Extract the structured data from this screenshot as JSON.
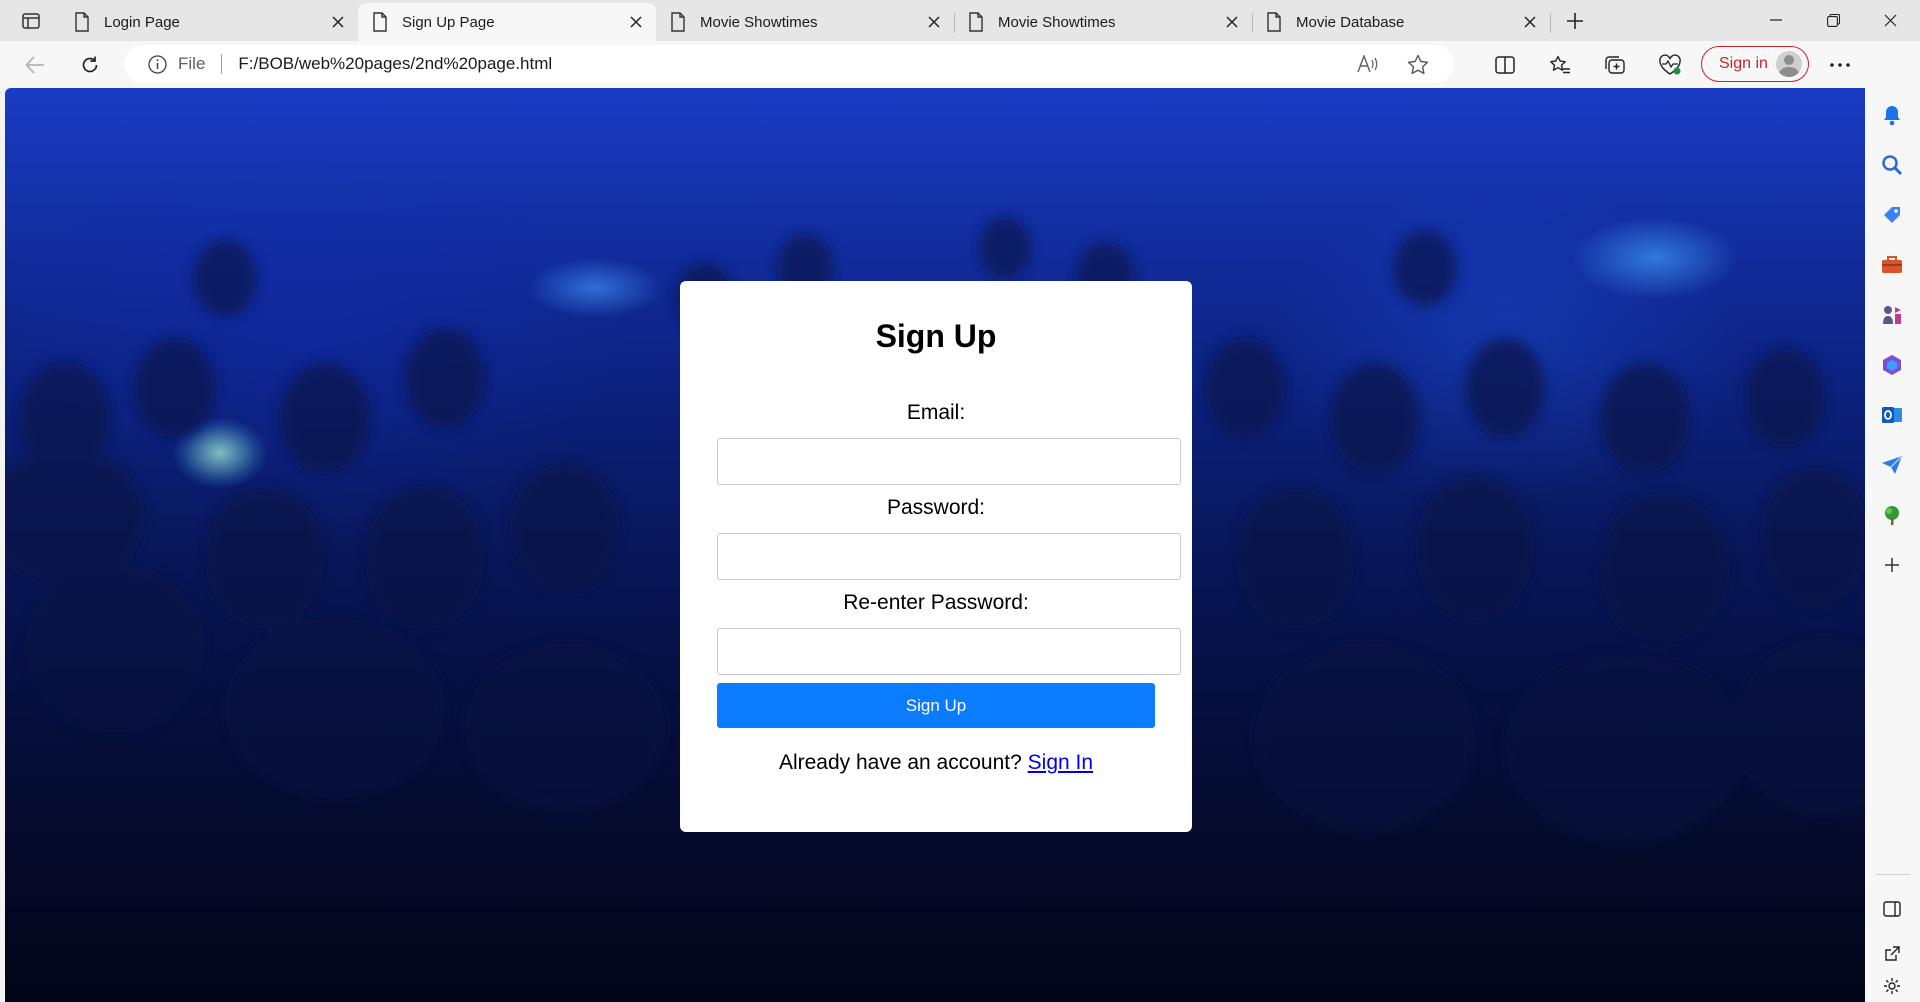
{
  "browser": {
    "tabs": [
      {
        "title": "Login Page",
        "active": false
      },
      {
        "title": "Sign Up Page",
        "active": true
      },
      {
        "title": "Movie Showtimes",
        "active": false
      },
      {
        "title": "Movie Showtimes",
        "active": false
      },
      {
        "title": "Movie Database",
        "active": false
      }
    ],
    "address": {
      "scheme_label": "File",
      "url": "F:/BOB/web%20pages/2nd%20page.html"
    },
    "signin_label": "Sign in",
    "accent_color": "#c4262e"
  },
  "form": {
    "title": "Sign Up",
    "email_label": "Email:",
    "password_label": "Password:",
    "reenter_label": "Re-enter Password:",
    "email_value": "",
    "password_value": "",
    "reenter_value": "",
    "submit_label": "Sign Up",
    "footer_text": "Already have an account?",
    "footer_link": "Sign In",
    "button_color": "#0a7cff"
  },
  "sidebar_icons": [
    "bell-icon",
    "search-icon",
    "tag-icon",
    "briefcase-icon",
    "games-icon",
    "office-icon",
    "outlook-icon",
    "send-icon",
    "tree-icon",
    "add-icon",
    "split-panel-icon",
    "external-link-icon",
    "settings-icon"
  ]
}
